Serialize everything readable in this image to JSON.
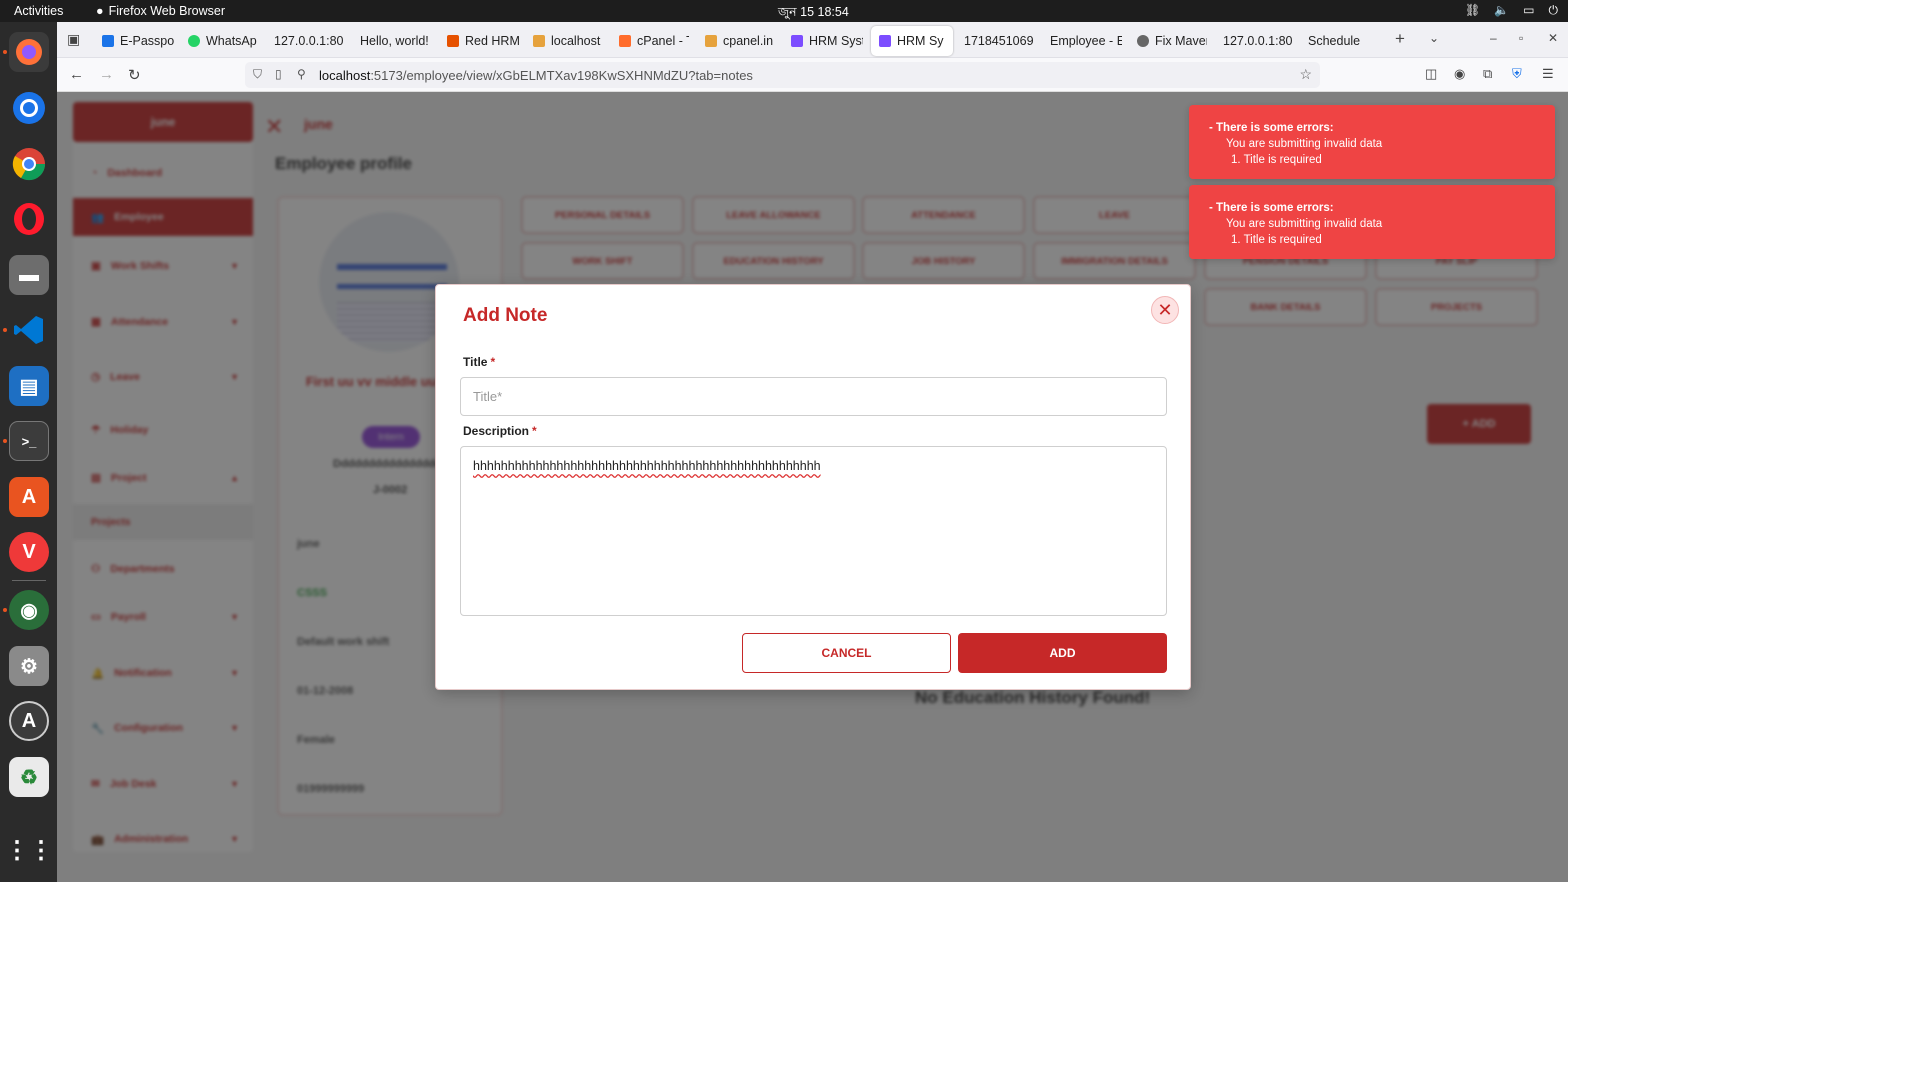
{
  "system": {
    "activities": "Activities",
    "browser_name": "Firefox Web Browser",
    "clock": "জুন 15  18:54"
  },
  "tabs": [
    {
      "label": "E-Passpo",
      "color": "#1a73e8"
    },
    {
      "label": "WhatsAp",
      "color": "#25d366"
    },
    {
      "label": "127.0.0.1:80",
      "color": ""
    },
    {
      "label": "Hello, world!",
      "color": ""
    },
    {
      "label": "Red HRM",
      "color": "#e65100"
    },
    {
      "label": "localhost",
      "color": "#e6a23c"
    },
    {
      "label": "cPanel - T",
      "color": "#ff6c2c"
    },
    {
      "label": "cpanel.in",
      "color": "#e6a23c"
    },
    {
      "label": "HRM Syst",
      "color": "#7c4dff"
    },
    {
      "label": "HRM Sy",
      "color": "#7c4dff"
    },
    {
      "label": "1718451069",
      "color": ""
    },
    {
      "label": "Employee - E",
      "color": ""
    },
    {
      "label": "Fix Maver",
      "color": "#666"
    },
    {
      "label": "127.0.0.1:80",
      "color": ""
    },
    {
      "label": "Schedule",
      "color": ""
    }
  ],
  "url": {
    "host": "localhost",
    "rest": ":5173/employee/view/xGbELMTXav198KwSXHNMdZU?tab=notes"
  },
  "background": {
    "user_name": "june",
    "page_title": "Employee profile",
    "sidebar": [
      {
        "label": "Dashboard"
      },
      {
        "label": "Employee"
      },
      {
        "label": "Work Shifts"
      },
      {
        "label": "Attendance"
      },
      {
        "label": "Leave"
      },
      {
        "label": "Holiday"
      },
      {
        "label": "Project"
      },
      {
        "label": "Projects"
      },
      {
        "label": "Departments"
      },
      {
        "label": "Payroll"
      },
      {
        "label": "Notification"
      },
      {
        "label": "Configuration"
      },
      {
        "label": "Job Desk"
      },
      {
        "label": "Administration"
      }
    ],
    "profile_tabs": [
      "PERSONAL DETAILS",
      "LEAVE ALLOWANCE",
      "ATTENDANCE",
      "LEAVE",
      "WORK SHIFT",
      "EDUCATION HISTORY",
      "JOB HISTORY",
      "IMMIGRATION DETAILS",
      "PENSION DETAILS",
      "PAY SLIP",
      "BANK DETAILS",
      "PROJECTS"
    ],
    "employee_name": "First uu vv middle uu uu vv",
    "badge": "Intern",
    "designation": "Dddddddddddddddd",
    "employee_id": "J-0002",
    "info": [
      "june",
      "CSSS",
      "Default work shift",
      "01-12-2008",
      "Female",
      "01999999999"
    ],
    "add_label": "+ ADD",
    "empty_message": "No Education History Found!"
  },
  "modal": {
    "title": "Add Note",
    "title_label": "Title",
    "title_value": "",
    "title_placeholder": "Title*",
    "description_label": "Description",
    "description_value": "hhhhhhhhhhhhhhhhhhhhhhhhhhhhhhhhhhhhhhhhhhhhhhhhhh",
    "required_mark": "*",
    "cancel_label": "CANCEL",
    "add_label": "ADD"
  },
  "toasts": [
    {
      "heading": "- There is some errors:",
      "message": "You are submitting invalid data",
      "item": "1. Title is required"
    },
    {
      "heading": "- There is some errors:",
      "message": "You are submitting invalid data",
      "item": "1. Title is required"
    }
  ],
  "colors": {
    "brand": "#c62828",
    "toast": "#ef4444"
  }
}
